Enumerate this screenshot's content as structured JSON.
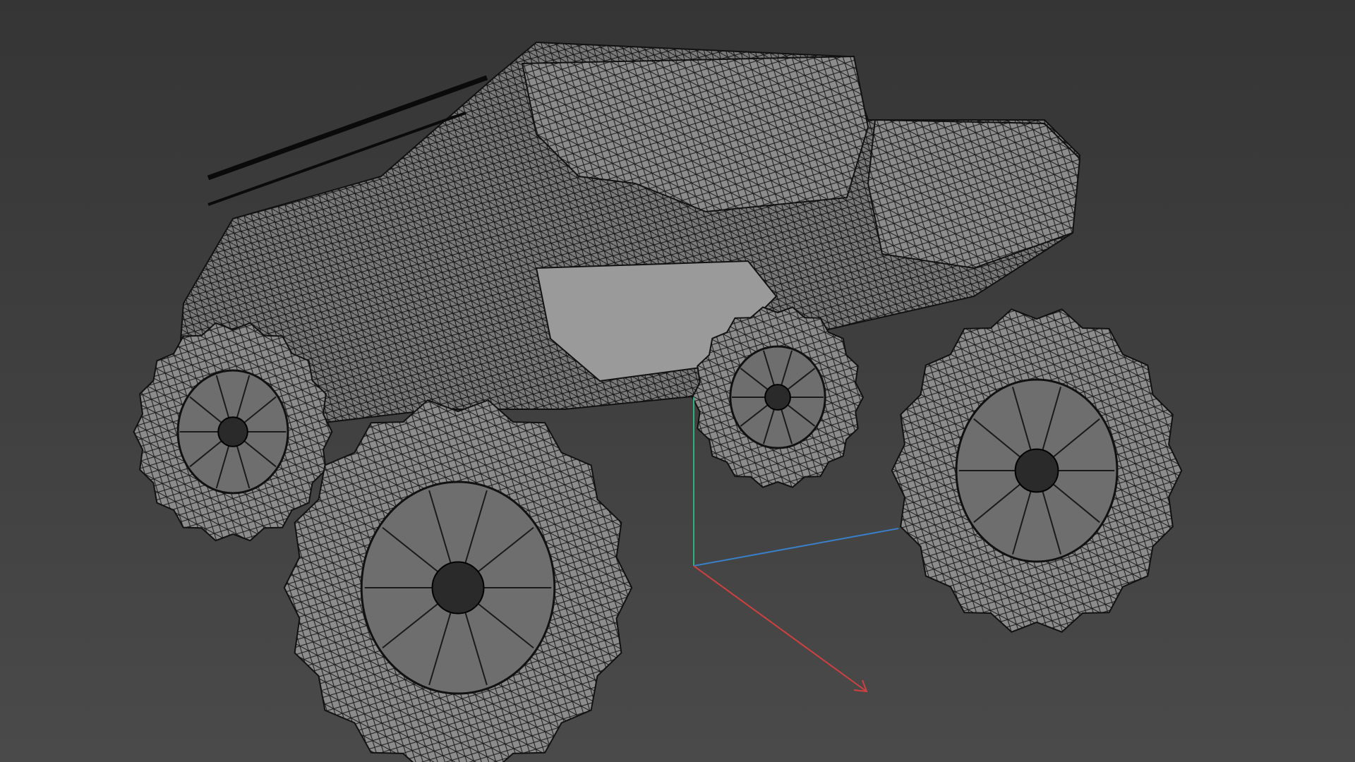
{
  "viewport": {
    "background_top": "#363636",
    "background_bottom": "#4a4a4a",
    "wire_color": "#111111",
    "surface_color": "#8a8a8a"
  },
  "gizmo": {
    "x_color": "#d04040",
    "y_color": "#30b080",
    "z_color": "#3a7fc8",
    "icon": "axis-gizmo-icon"
  },
  "model": {
    "icon": "wireframe-truck-model"
  }
}
